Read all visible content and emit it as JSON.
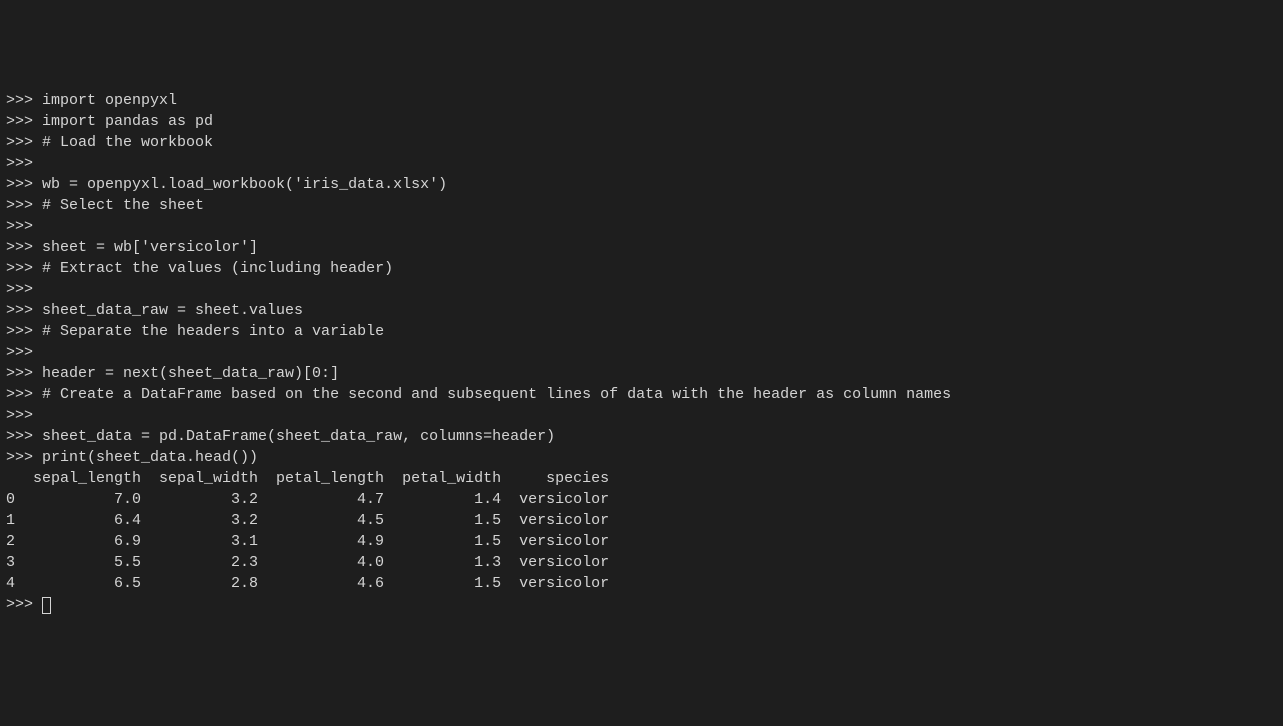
{
  "lines": [
    {
      "prompt": ">>> ",
      "text": "import openpyxl"
    },
    {
      "prompt": ">>> ",
      "text": "import pandas as pd"
    },
    {
      "prompt": ">>> ",
      "text": "# Load the workbook"
    },
    {
      "prompt": ">>> ",
      "text": ""
    },
    {
      "prompt": ">>> ",
      "text": "wb = openpyxl.load_workbook('iris_data.xlsx')"
    },
    {
      "prompt": ">>> ",
      "text": "# Select the sheet"
    },
    {
      "prompt": ">>> ",
      "text": ""
    },
    {
      "prompt": ">>> ",
      "text": "sheet = wb['versicolor']"
    },
    {
      "prompt": ">>> ",
      "text": "# Extract the values (including header)"
    },
    {
      "prompt": ">>> ",
      "text": ""
    },
    {
      "prompt": ">>> ",
      "text": "sheet_data_raw = sheet.values"
    },
    {
      "prompt": ">>> ",
      "text": "# Separate the headers into a variable"
    },
    {
      "prompt": ">>> ",
      "text": ""
    },
    {
      "prompt": ">>> ",
      "text": "header = next(sheet_data_raw)[0:]"
    },
    {
      "prompt": ">>> ",
      "text": "# Create a DataFrame based on the second and subsequent lines of data with the header as column names"
    },
    {
      "prompt": ">>> ",
      "text": ""
    },
    {
      "prompt": ">>> ",
      "text": "sheet_data = pd.DataFrame(sheet_data_raw, columns=header)"
    },
    {
      "prompt": ">>> ",
      "text": "print(sheet_data.head())"
    }
  ],
  "output_header": "   sepal_length  sepal_width  petal_length  petal_width     species",
  "output_rows": [
    "0           7.0          3.2           4.7          1.4  versicolor",
    "1           6.4          3.2           4.5          1.5  versicolor",
    "2           6.9          3.1           4.9          1.5  versicolor",
    "3           5.5          2.3           4.0          1.3  versicolor",
    "4           6.5          2.8           4.6          1.5  versicolor"
  ],
  "final_prompt": ">>> ",
  "chart_data": {
    "type": "table",
    "title": "sheet_data.head()",
    "columns": [
      "sepal_length",
      "sepal_width",
      "petal_length",
      "petal_width",
      "species"
    ],
    "index": [
      0,
      1,
      2,
      3,
      4
    ],
    "rows": [
      [
        7.0,
        3.2,
        4.7,
        1.4,
        "versicolor"
      ],
      [
        6.4,
        3.2,
        4.5,
        1.5,
        "versicolor"
      ],
      [
        6.9,
        3.1,
        4.9,
        1.5,
        "versicolor"
      ],
      [
        5.5,
        2.3,
        4.0,
        1.3,
        "versicolor"
      ],
      [
        6.5,
        2.8,
        4.6,
        1.5,
        "versicolor"
      ]
    ]
  }
}
